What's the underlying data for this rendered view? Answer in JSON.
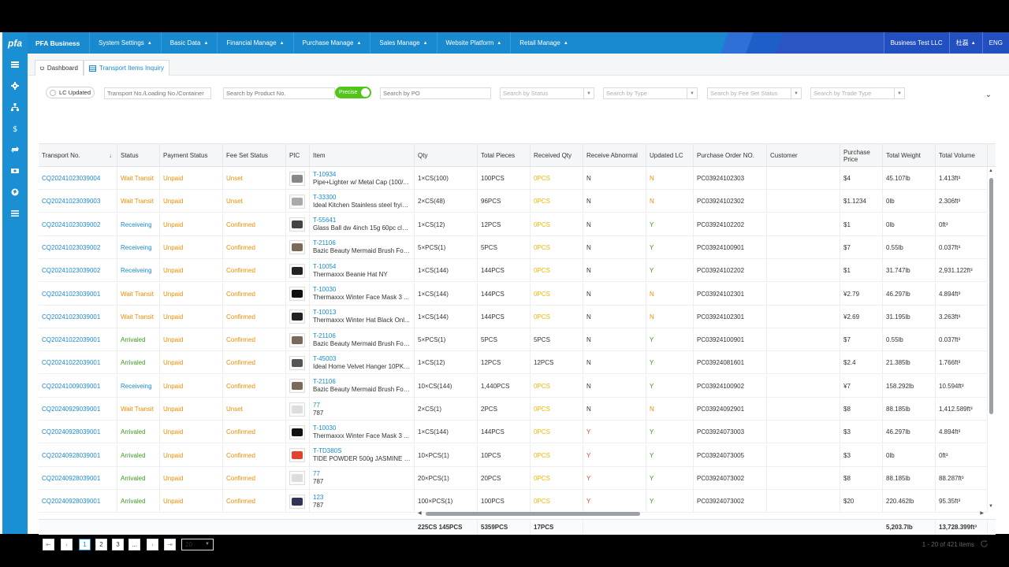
{
  "app": {
    "logo": "pfa",
    "brand": "PFA Business",
    "menu": [
      {
        "label": "System Settings"
      },
      {
        "label": "Basic Data"
      },
      {
        "label": "Financial Manage"
      },
      {
        "label": "Purchase Manage"
      },
      {
        "label": "Sales Manage"
      },
      {
        "label": "Website Platform"
      },
      {
        "label": "Retail Manage"
      }
    ],
    "company": "Business Test LLC",
    "user": "杜磊",
    "language": "ENG"
  },
  "tabs": [
    {
      "label": "Dashboard"
    },
    {
      "label": "Transport Items Inquiry"
    }
  ],
  "filters": {
    "lc_updated": "LC Updated",
    "transport_placeholder": "Transport No./Loading No./Container",
    "product_placeholder": "Search by Product No.",
    "precise_label": "Precise",
    "po_placeholder": "Search by PO",
    "status_placeholder": "Search by Status",
    "type_placeholder": "Search by Type",
    "fee_placeholder": "Search by Fee Set Status",
    "trade_placeholder": "Search by Trade Type"
  },
  "table": {
    "columns": [
      "Transport No.",
      "Status",
      "Payment Status",
      "Fee Set Status",
      "PIC",
      "Item",
      "Qty",
      "Total Pieces",
      "Received Qty",
      "Receive Abnormal",
      "Updated LC",
      "Purchase Order NO.",
      "Customer",
      "Purchase Price",
      "Total Weight",
      "Total Volume"
    ],
    "rows": [
      {
        "transport": "CQ20241023039004",
        "status": "Wait Transit",
        "payment": "Unpaid",
        "fee": "Unset",
        "code": "T-10934",
        "desc": "Pipe+Lighter w/ Metal Cap (100/...",
        "qty": "1×CS(100)",
        "pieces": "100PCS",
        "received": "0PCS",
        "abnormal": "N",
        "lc": "N",
        "po": "PC03924102303",
        "customer": "",
        "price": "$4",
        "weight": "45.107lb",
        "volume": "1.413ft³"
      },
      {
        "transport": "CQ20241023039003",
        "status": "Wait Transit",
        "payment": "Unpaid",
        "fee": "Unset",
        "code": "T-33300",
        "desc": "Ideal Kitchen Stainless steel fryin...",
        "qty": "2×CS(48)",
        "pieces": "96PCS",
        "received": "0PCS",
        "abnormal": "N",
        "lc": "N",
        "po": "PC03924102302",
        "customer": "",
        "price": "$1.1234",
        "weight": "0lb",
        "volume": "2.306ft³"
      },
      {
        "transport": "CQ20241023039002",
        "status": "Receiveing",
        "payment": "Unpaid",
        "fee": "Confirmed",
        "code": "T-55641",
        "desc": "Glass Ball dw 4inch 15g 60pc cle...",
        "qty": "1×CS(12)",
        "pieces": "12PCS",
        "received": "0PCS",
        "abnormal": "N",
        "lc": "Y",
        "po": "PC03924102202",
        "customer": "",
        "price": "$1",
        "weight": "0lb",
        "volume": "0ft³"
      },
      {
        "transport": "CQ20241023039002",
        "status": "Receiveing",
        "payment": "Unpaid",
        "fee": "Confirmed",
        "code": "T-21106",
        "desc": "Bazic Beauty Mermaid Brush Fou...",
        "qty": "5×PCS(1)",
        "pieces": "5PCS",
        "received": "0PCS",
        "abnormal": "N",
        "lc": "Y",
        "po": "PC03924100901",
        "customer": "",
        "price": "$7",
        "weight": "0.55lb",
        "volume": "0.037ft³"
      },
      {
        "transport": "CQ20241023039002",
        "status": "Receiveing",
        "payment": "Unpaid",
        "fee": "Confirmed",
        "code": "T-10054",
        "desc": "Thermaxxx Beanie Hat NY",
        "qty": "1×CS(144)",
        "pieces": "144PCS",
        "received": "0PCS",
        "abnormal": "N",
        "lc": "Y",
        "po": "PC03924102202",
        "customer": "",
        "price": "$1",
        "weight": "31.747lb",
        "volume": "2,931.122ft³"
      },
      {
        "transport": "CQ20241023039001",
        "status": "Wait Transit",
        "payment": "Unpaid",
        "fee": "Confirmed",
        "code": "T-10030",
        "desc": "Thermaxxx Winter Face Mask 3 ...",
        "qty": "1×CS(144)",
        "pieces": "144PCS",
        "received": "0PCS",
        "abnormal": "N",
        "lc": "N",
        "po": "PC03924102301",
        "customer": "",
        "price": "¥2.79",
        "weight": "46.297lb",
        "volume": "4.894ft³"
      },
      {
        "transport": "CQ20241023039001",
        "status": "Wait Transit",
        "payment": "Unpaid",
        "fee": "Confirmed",
        "code": "T-10013",
        "desc": "Thermaxxx Winter Hat Black Onl...",
        "qty": "1×CS(144)",
        "pieces": "144PCS",
        "received": "0PCS",
        "abnormal": "N",
        "lc": "N",
        "po": "PC03924102301",
        "customer": "",
        "price": "¥2.69",
        "weight": "31.195lb",
        "volume": "3.263ft³"
      },
      {
        "transport": "CQ20241022039001",
        "status": "Arrivaled",
        "payment": "Unpaid",
        "fee": "Confirmed",
        "code": "T-21106",
        "desc": "Bazic Beauty Mermaid Brush Fou...",
        "qty": "5×PCS(1)",
        "pieces": "5PCS",
        "received": "5PCS",
        "abnormal": "N",
        "lc": "Y",
        "po": "PC03924100901",
        "customer": "",
        "price": "$7",
        "weight": "0.55lb",
        "volume": "0.037ft³"
      },
      {
        "transport": "CQ20241022039001",
        "status": "Arrivaled",
        "payment": "Unpaid",
        "fee": "Confirmed",
        "code": "T-45003",
        "desc": "Ideal Home Velvet Hanger 10PK ...",
        "qty": "1×CS(12)",
        "pieces": "12PCS",
        "received": "12PCS",
        "abnormal": "N",
        "lc": "Y",
        "po": "PC03924081601",
        "customer": "",
        "price": "$2.4",
        "weight": "21.385lb",
        "volume": "1.766ft³"
      },
      {
        "transport": "CQ20241009039001",
        "status": "Receiveing",
        "payment": "Unpaid",
        "fee": "Confirmed",
        "code": "T-21106",
        "desc": "Bazic Beauty Mermaid Brush Fou...",
        "qty": "10×CS(144)",
        "pieces": "1,440PCS",
        "received": "0PCS",
        "abnormal": "N",
        "lc": "Y",
        "po": "PC03924100902",
        "customer": "",
        "price": "¥7",
        "weight": "158.292lb",
        "volume": "10.594ft³"
      },
      {
        "transport": "CQ20240929039001",
        "status": "Wait Transit",
        "payment": "Unpaid",
        "fee": "Unset",
        "code": "77",
        "desc": "787",
        "qty": "2×CS(1)",
        "pieces": "2PCS",
        "received": "0PCS",
        "abnormal": "N",
        "lc": "N",
        "po": "PC03924092901",
        "customer": "",
        "price": "$8",
        "weight": "88.185lb",
        "volume": "1,412.589ft³"
      },
      {
        "transport": "CQ20240928039001",
        "status": "Arrivaled",
        "payment": "Unpaid",
        "fee": "Confirmed",
        "code": "T-10030",
        "desc": "Thermaxxx Winter Face Mask 3 ...",
        "qty": "1×CS(144)",
        "pieces": "144PCS",
        "received": "0PCS",
        "abnormal": "Y",
        "lc": "Y",
        "po": "PC03924073003",
        "customer": "",
        "price": "$3",
        "weight": "46.297lb",
        "volume": "4.894ft³"
      },
      {
        "transport": "CQ20240928039001",
        "status": "Arrivaled",
        "payment": "Unpaid",
        "fee": "Confirmed",
        "code": "T-TD380S",
        "desc": "TIDE POWDER 500g JASMINE R...",
        "qty": "10×PCS(1)",
        "pieces": "10PCS",
        "received": "0PCS",
        "abnormal": "Y",
        "lc": "Y",
        "po": "PC03924073005",
        "customer": "",
        "price": "$3",
        "weight": "0lb",
        "volume": "0ft³"
      },
      {
        "transport": "CQ20240928039001",
        "status": "Arrivaled",
        "payment": "Unpaid",
        "fee": "Confirmed",
        "code": "77",
        "desc": "787",
        "qty": "20×PCS(1)",
        "pieces": "20PCS",
        "received": "0PCS",
        "abnormal": "Y",
        "lc": "Y",
        "po": "PC03924073002",
        "customer": "",
        "price": "$8",
        "weight": "88.185lb",
        "volume": "88.287ft³"
      },
      {
        "transport": "CQ20240928039001",
        "status": "Arrivaled",
        "payment": "Unpaid",
        "fee": "Confirmed",
        "code": "123",
        "desc": "787",
        "qty": "100×PCS(1)",
        "pieces": "100PCS",
        "received": "0PCS",
        "abnormal": "Y",
        "lc": "Y",
        "po": "PC03924073002",
        "customer": "",
        "price": "$20",
        "weight": "220.462lb",
        "volume": "95.35ft³"
      }
    ],
    "totals": {
      "qty": "225CS 145PCS",
      "pieces": "5359PCS",
      "received": "17PCS",
      "weight": "5,203.7lb",
      "volume": "13,728.399ft³"
    }
  },
  "pagination": {
    "pages": [
      "1",
      "2",
      "3",
      "..."
    ],
    "page_size": "20",
    "info": "1 - 20 of 421 items"
  },
  "colors": {
    "primary": "#1a8ad0",
    "wait_transit": "#f08c00",
    "receiving": "#1a8ad0",
    "arrived": "#3a9a1e",
    "unpaid": "#f08c00",
    "unset": "#f08c00",
    "confirmed": "#f08c00",
    "zero_received": "#f2b400"
  }
}
